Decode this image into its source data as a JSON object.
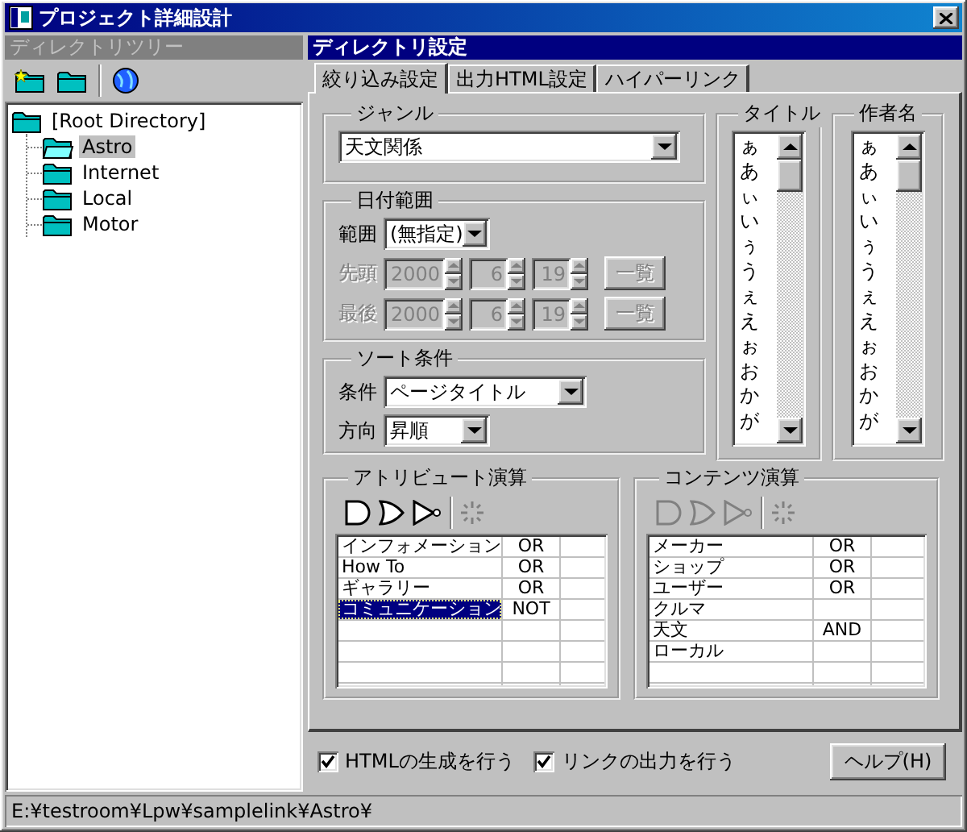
{
  "window": {
    "title": "プロジェクト詳細設計"
  },
  "tree_panel": {
    "header": "ディレクトリツリー",
    "active": false,
    "tree": [
      {
        "label": "[Root Directory]",
        "selected": false,
        "children": [
          {
            "label": "Astro",
            "selected": true
          },
          {
            "label": "Internet",
            "selected": false
          },
          {
            "label": "Local",
            "selected": false
          },
          {
            "label": "Motor",
            "selected": false
          }
        ]
      }
    ]
  },
  "settings_panel": {
    "header": "ディレクトリ設定",
    "active": true,
    "tabs": [
      {
        "label": "絞り込み設定",
        "selected": true
      },
      {
        "label": "出力HTML設定",
        "selected": false
      },
      {
        "label": "ハイパーリンク",
        "selected": false
      }
    ],
    "genre": {
      "label": "ジャンル",
      "value": "天文関係"
    },
    "date_range": {
      "label": "日付範囲",
      "range_label": "範囲",
      "range_value": "(無指定)",
      "rows": [
        {
          "label": "先頭",
          "year": "2000",
          "month": "6",
          "day": "19",
          "button": "一覧",
          "disabled": true
        },
        {
          "label": "最後",
          "year": "2000",
          "month": "6",
          "day": "19",
          "button": "一覧",
          "disabled": true
        }
      ]
    },
    "sort": {
      "label": "ソート条件",
      "fields": [
        {
          "label": "条件",
          "value": "ページタイトル"
        },
        {
          "label": "方向",
          "value": "昇順"
        }
      ]
    },
    "lists": [
      {
        "label": "タイトル",
        "items": [
          "ぁ",
          "あ",
          "ぃ",
          "い",
          "ぅ",
          "う",
          "ぇ",
          "え",
          "ぉ",
          "お",
          "か",
          "が"
        ]
      },
      {
        "label": "作者名",
        "items": [
          "ぁ",
          "あ",
          "ぃ",
          "い",
          "ぅ",
          "う",
          "ぇ",
          "え",
          "ぉ",
          "お",
          "か",
          "が"
        ]
      }
    ],
    "operations": [
      {
        "label": "アトリビュート演算",
        "disabled": false,
        "rows": [
          {
            "name": "インフォメーション",
            "op": "OR",
            "selected": false
          },
          {
            "name": "How To",
            "op": "OR",
            "selected": false
          },
          {
            "name": "ギャラリー",
            "op": "OR",
            "selected": false
          },
          {
            "name": "コミュニケーション",
            "op": "NOT",
            "selected": true
          }
        ]
      },
      {
        "label": "コンテンツ演算",
        "disabled": true,
        "rows": [
          {
            "name": "メーカー",
            "op": "OR",
            "selected": false
          },
          {
            "name": "ショップ",
            "op": "OR",
            "selected": false
          },
          {
            "name": "ユーザー",
            "op": "OR",
            "selected": false
          },
          {
            "name": "クルマ",
            "selected": false
          },
          {
            "name": "天文",
            "op": "AND",
            "selected": false
          },
          {
            "name": "ローカル",
            "selected": false
          }
        ]
      }
    ],
    "options": [
      {
        "label": "HTMLの生成を行う",
        "checked": true
      },
      {
        "label": "リンクの出力を行う",
        "checked": true
      }
    ],
    "help_button": "ヘルプ(H)"
  },
  "status_bar": "E:¥testroom¥Lpw¥samplelink¥Astro¥"
}
